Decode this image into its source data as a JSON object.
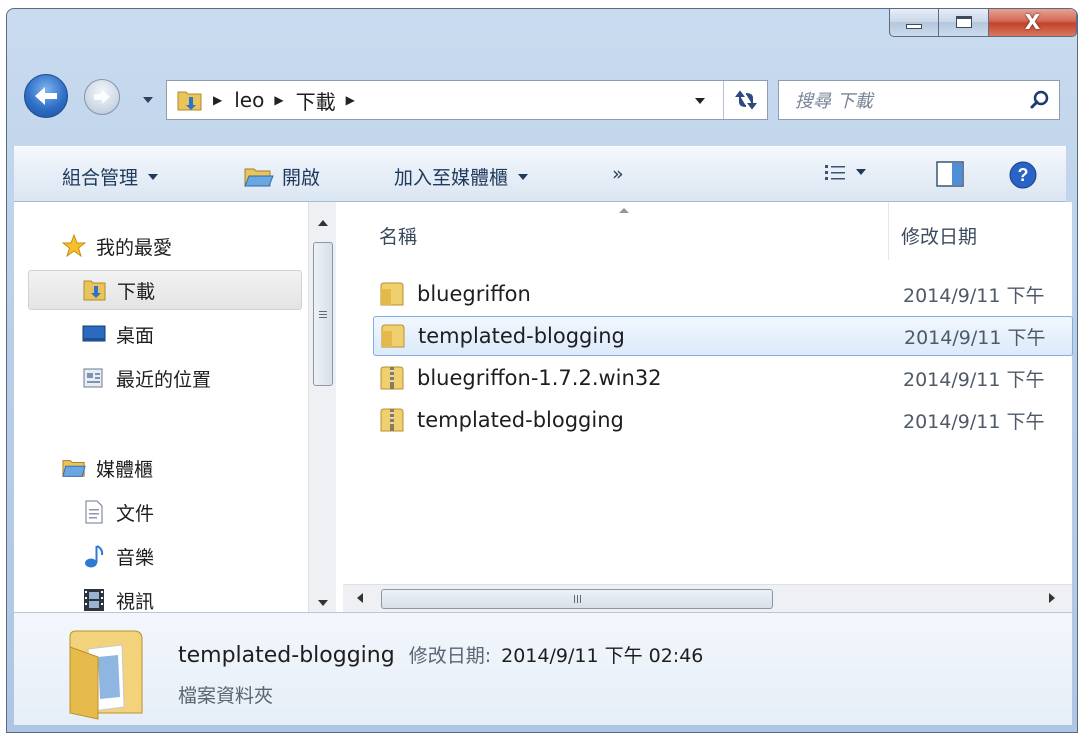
{
  "window": {
    "close_glyph": "X"
  },
  "address": {
    "crumbs": [
      "leo",
      "下載"
    ]
  },
  "search": {
    "placeholder": "搜尋 下載"
  },
  "toolbar": {
    "organize": "組合管理",
    "open": "開啟",
    "add_to_library": "加入至媒體櫃",
    "more": "»"
  },
  "sidebar": {
    "favorites": "我的最愛",
    "downloads": "下載",
    "desktop": "桌面",
    "recent_places": "最近的位置",
    "libraries": "媒體櫃",
    "documents": "文件",
    "music": "音樂",
    "videos": "視訊"
  },
  "columns": {
    "name": "名稱",
    "date_modified": "修改日期"
  },
  "files": [
    {
      "name": "bluegriffon",
      "date": "2014/9/11 下午",
      "type": "folder"
    },
    {
      "name": "templated-blogging",
      "date": "2014/9/11 下午",
      "type": "folder"
    },
    {
      "name": "bluegriffon-1.7.2.win32",
      "date": "2014/9/11 下午",
      "type": "zip"
    },
    {
      "name": "templated-blogging",
      "date": "2014/9/11 下午",
      "type": "zip"
    }
  ],
  "details": {
    "name": "templated-blogging",
    "modified_label": "修改日期:",
    "modified_value": "2014/9/11 下午 02:46",
    "type": "檔案資料夾"
  },
  "scroll": {
    "grip": "III"
  },
  "colors": {
    "selection_border": "#84acdd",
    "window_frame": "#b9cfe8",
    "close_red": "#c2432d"
  }
}
